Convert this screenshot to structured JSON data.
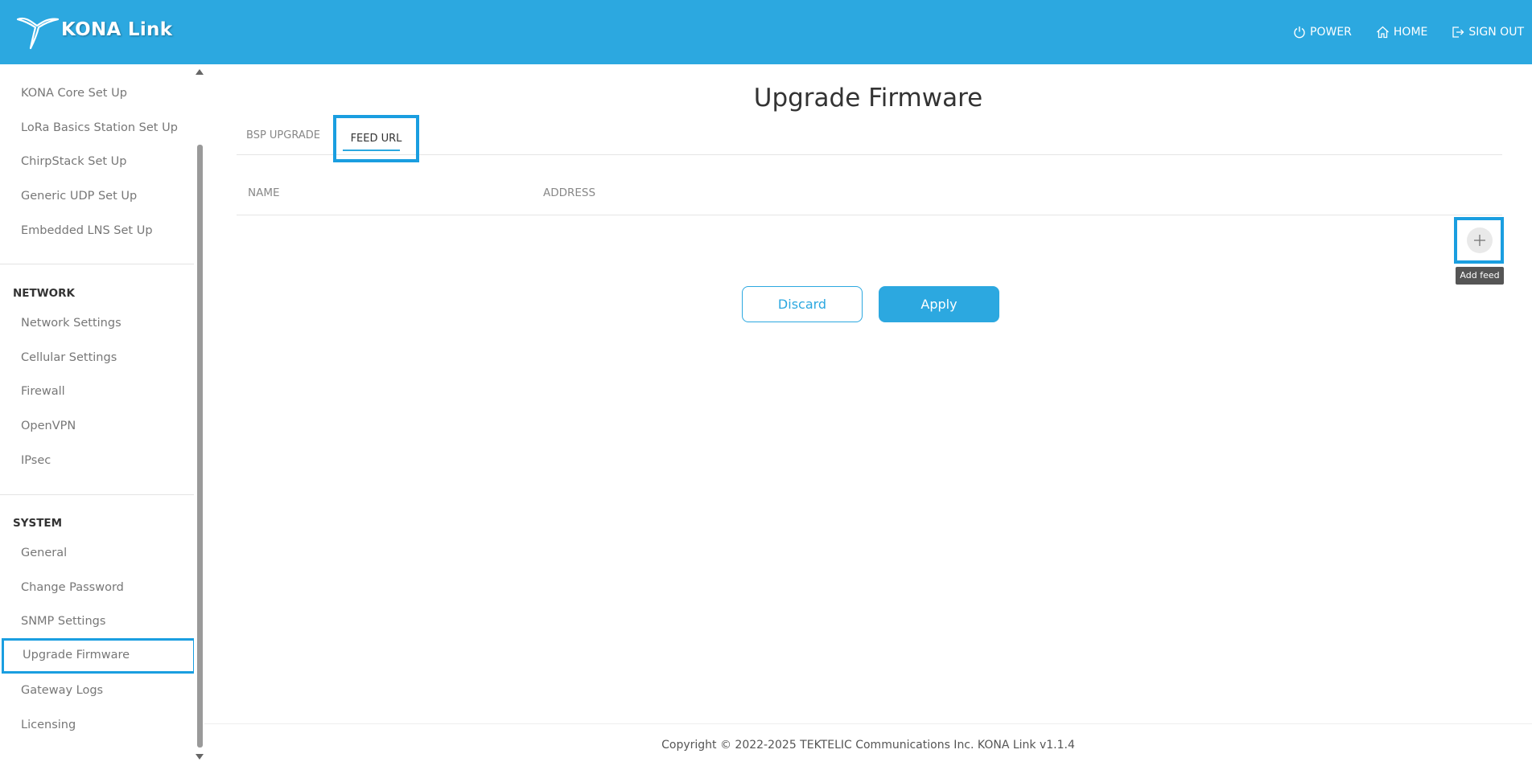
{
  "header": {
    "brand": "KONA Link",
    "nav": [
      {
        "label": "POWER",
        "icon": "power-icon"
      },
      {
        "label": "HOME",
        "icon": "home-icon"
      },
      {
        "label": "SIGN OUT",
        "icon": "sign-out-icon"
      }
    ],
    "bg_color": "#2ca8e0"
  },
  "sidebar": {
    "items_top": [
      {
        "label": "KONA Core Set Up"
      },
      {
        "label": "LoRa Basics Station Set Up"
      },
      {
        "label": "ChirpStack Set Up"
      },
      {
        "label": "Generic UDP Set Up"
      },
      {
        "label": "Embedded LNS Set Up"
      }
    ],
    "network": {
      "title": "NETWORK",
      "items": [
        {
          "label": "Network Settings"
        },
        {
          "label": "Cellular Settings"
        },
        {
          "label": "Firewall"
        },
        {
          "label": "OpenVPN"
        },
        {
          "label": "IPsec"
        }
      ]
    },
    "system": {
      "title": "SYSTEM",
      "items": [
        {
          "label": "General"
        },
        {
          "label": "Change Password"
        },
        {
          "label": "SNMP Settings"
        },
        {
          "label": "Upgrade Firmware",
          "active": true
        },
        {
          "label": "Gateway Logs"
        },
        {
          "label": "Licensing"
        }
      ]
    }
  },
  "main": {
    "title": "Upgrade Firmware",
    "tabs": [
      {
        "label": "BSP UPGRADE"
      },
      {
        "label": "FEED URL",
        "active": true
      }
    ],
    "table": {
      "columns": [
        "NAME",
        "ADDRESS"
      ],
      "rows": []
    },
    "add_tooltip": "Add feed",
    "discard_label": "Discard",
    "apply_label": "Apply"
  },
  "footer": {
    "text": "Copyright © 2022-2025 TEKTELIC Communications Inc. KONA Link v1.1.4"
  }
}
